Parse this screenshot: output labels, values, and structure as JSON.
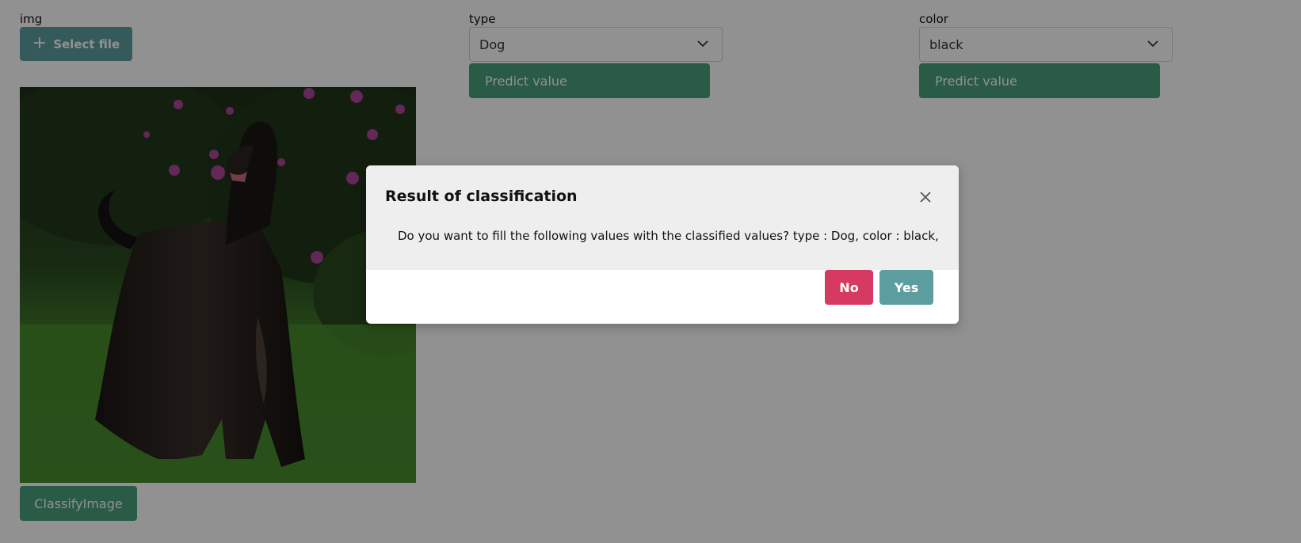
{
  "fields": {
    "img": {
      "label": "img",
      "select_file_label": "Select file",
      "select_file_icon": "plus-icon",
      "image_description": "black-afghan-hound-photo",
      "classify_label": "ClassifyImage"
    },
    "type": {
      "label": "type",
      "value": "Dog",
      "predict_label": "Predict value",
      "dropdown_icon": "chevron-down-icon"
    },
    "color": {
      "label": "color",
      "value": "black",
      "predict_label": "Predict value",
      "dropdown_icon": "chevron-down-icon"
    }
  },
  "modal": {
    "title": "Result of classification",
    "message": "Do you want to fill the following values with the classified values? type : Dog, color : black,",
    "no_label": "No",
    "yes_label": "Yes",
    "close_icon": "close-icon"
  },
  "colors": {
    "accent_teal": "#5c9ea0",
    "predict_green": "#48a17c",
    "no_red": "#d63a63",
    "overlay": "rgba(0,0,0,0.43)"
  }
}
